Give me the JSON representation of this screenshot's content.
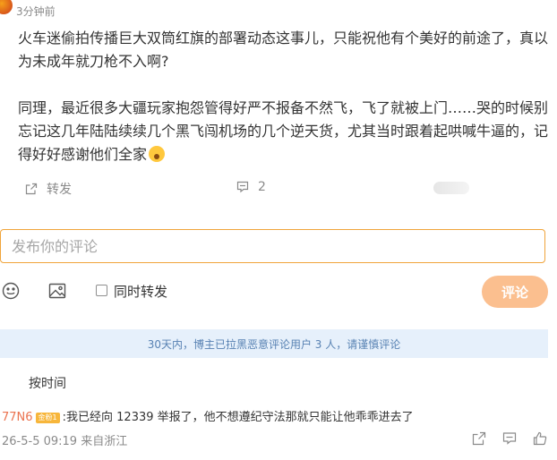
{
  "post": {
    "time": "3分钟前",
    "paragraphs": [
      "火车迷偷拍传播巨大双筒红旗的部署动态这事儿，只能祝他有个美好的前途了，真以为未成年就刀枪不入啊?",
      "同理，最近很多大疆玩家抱怨管得好严不报备不然飞，飞了就被上门……哭的时候别忘记这几年陆陆续续几个黑飞闯机场的几个逆天货，尤其当时跟着起哄喊牛逼的，记得好好感谢他们全家"
    ],
    "repost_label": "转发",
    "comment_count": "2"
  },
  "composer": {
    "placeholder": "发布你的评论",
    "sync_repost_label": "同时转发",
    "submit_label": "评论"
  },
  "notice": "30天内，博主已拉黑恶意评论用户 3 人，请谨慎评论",
  "sort_label": "按时间",
  "reply": {
    "user": "77N6",
    "badge": "金粉1",
    "text": ":我已经向 12339 举报了，他不想遵纪守法那就只能让他乖乖进去了",
    "meta": "26-5-5 09:19 来自浙江"
  }
}
